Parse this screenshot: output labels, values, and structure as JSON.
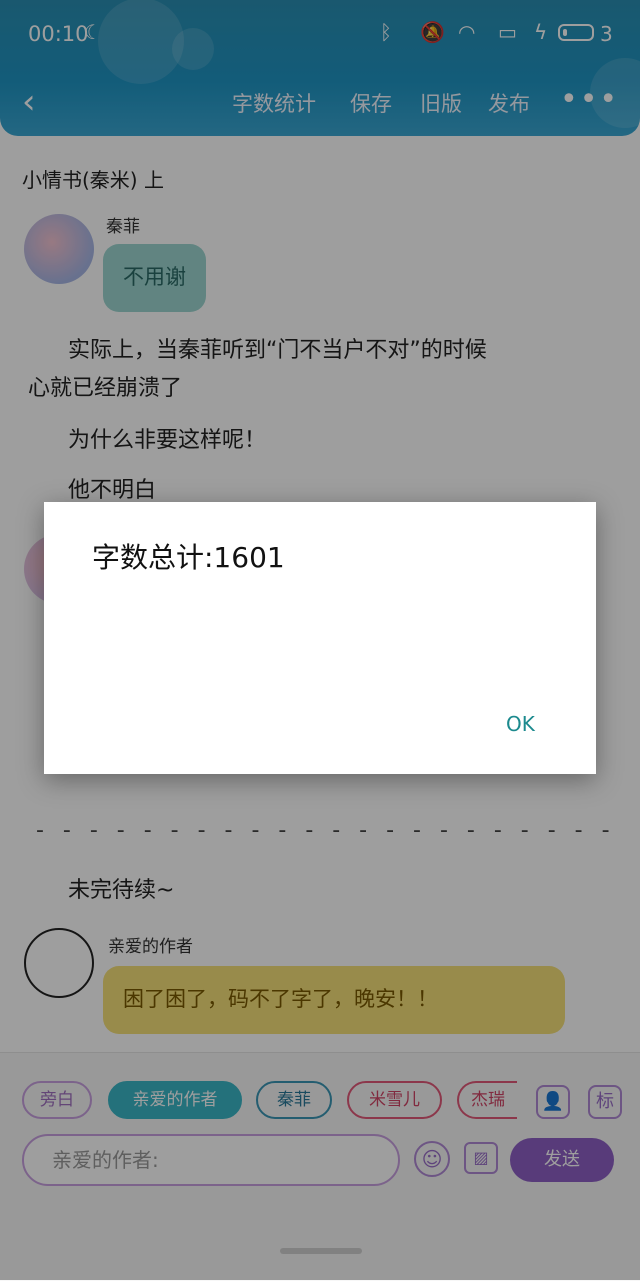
{
  "status_bar": {
    "time": "00:10",
    "battery_level": "3",
    "icons": [
      "moon-icon",
      "bluetooth-icon",
      "mute-icon",
      "wifi-icon",
      "screen-icon",
      "charging-icon",
      "battery-icon"
    ]
  },
  "nav": {
    "word_count": "字数统计",
    "save": "保存",
    "old_version": "旧版",
    "publish": "发布",
    "more": "•••"
  },
  "chapter": {
    "title": "小情书(秦米) 上"
  },
  "messages": [
    {
      "speaker": "秦菲",
      "text": "不用谢"
    }
  ],
  "paragraphs": [
    "实际上，当秦菲听到“门不当户不对”的时候",
    "心就已经崩溃了",
    "为什么非要这样呢！",
    "他不明白"
  ],
  "separator": "- - - - - - - - - - - - - - - - - - - - - -",
  "ending": "未完待续~",
  "author_message": {
    "speaker": "亲爱的作者",
    "text": "困了困了，码不了字了，晚安！！"
  },
  "character_chips": [
    "旁白",
    "亲爱的作者",
    "秦菲",
    "米雪儿",
    "杰瑞"
  ],
  "tool_icons": [
    "person-icon",
    "label-icon"
  ],
  "label_icon_text": "标",
  "input": {
    "placeholder": "亲爱的作者:"
  },
  "send_label": "发送",
  "dialog": {
    "message": "字数总计:1601",
    "ok_label": "OK"
  },
  "colors": {
    "header": "#1f95c4",
    "accent_teal": "#3bb6c7",
    "accent_purple": "#8e60c6",
    "dialog_ok": "#1c8a8e"
  }
}
